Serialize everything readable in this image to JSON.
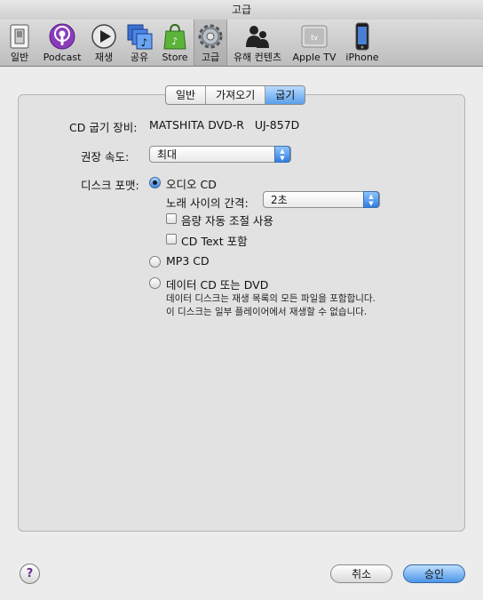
{
  "window": {
    "title": "고급"
  },
  "toolbar": {
    "items": [
      {
        "label": "일반",
        "icon": "general-switch-icon"
      },
      {
        "label": "Podcast",
        "icon": "podcast-icon"
      },
      {
        "label": "재생",
        "icon": "play-icon"
      },
      {
        "label": "공유",
        "icon": "sharing-music-icon"
      },
      {
        "label": "Store",
        "icon": "store-bag-icon"
      },
      {
        "label": "고급",
        "icon": "gear-icon"
      },
      {
        "label": "유해 컨텐츠",
        "icon": "parental-icon"
      },
      {
        "label": "Apple TV",
        "icon": "apple-tv-icon"
      },
      {
        "label": "iPhone",
        "icon": "iphone-icon"
      }
    ],
    "selected": "고급"
  },
  "tabs": [
    "일반",
    "가져오기",
    "굽기"
  ],
  "active_tab": "굽기",
  "burn": {
    "device_label": "CD 굽기 장비:",
    "device_value": "MATSHITA DVD-R   UJ-857D",
    "speed_label": "권장 속도:",
    "speed_value": "최대",
    "format_label": "디스크 포맷:",
    "audio_cd": "오디오 CD",
    "gap_label": "노래 사이의 간격:",
    "gap_value": "2초",
    "sound_check": "음량 자동 조절 사용",
    "cd_text": "CD Text 포함",
    "mp3_cd": "MP3 CD",
    "data_cd": "데이터 CD 또는 DVD",
    "data_desc_1": "데이터 디스크는 재생 목록의 모든 파일을 포함합니다.",
    "data_desc_2": "이 디스크는 일부 플레이어에서 재생할 수 없습니다.",
    "selected_format": "오디오 CD",
    "sound_check_checked": false,
    "cd_text_checked": false
  },
  "buttons": {
    "help": "?",
    "cancel": "취소",
    "ok": "승인"
  }
}
